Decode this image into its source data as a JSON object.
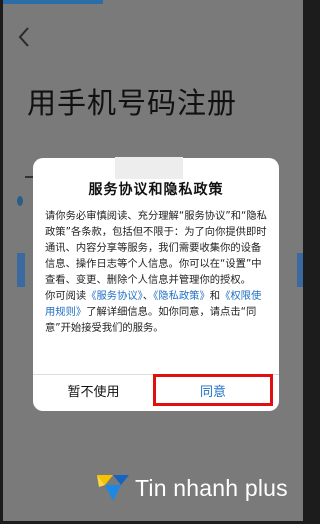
{
  "page": {
    "title": "用手机号码注册",
    "back_icon": "chevron-left-icon"
  },
  "dialog": {
    "title": "服务协议和隐私政策",
    "para1": "请你务必审慎阅读、充分理解“服务协议”和“隐私政策”各条款，包括但不限于：为了向你提供即时通讯、内容分享等服务，我们需要收集你的设备信息、操作日志等个人信息。你可以在“设置”中查看、变更、删除个人信息并管理你的授权。",
    "para2_prefix": "你可阅读",
    "link_service": "《服务协议》",
    "sep1": "、",
    "link_privacy": "《隐私政策》",
    "sep2": "和",
    "link_permissions": "《权限使用规则》",
    "para2_suffix": "了解详细信息。如你同意，请点击“同意”开始接受我们的服务。",
    "decline_label": "暂不使用",
    "agree_label": "同意"
  },
  "watermark": {
    "text": "Tin nhanh plus"
  },
  "colors": {
    "accent": "#1f6fc4",
    "highlight": "#e01010",
    "overlay": "#7a7a7a",
    "logo_yellow": "#f5c400",
    "logo_blue": "#1565c0"
  }
}
